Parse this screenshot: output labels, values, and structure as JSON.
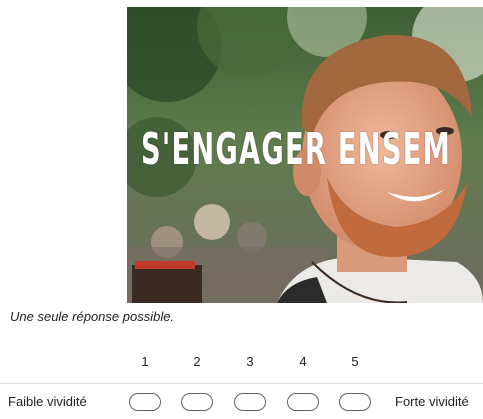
{
  "banner": {
    "overlay_text": "S'ENGAGER ENSEM"
  },
  "question": {
    "hint": "Une seule réponse possible.",
    "scale": [
      "1",
      "2",
      "3",
      "4",
      "5"
    ],
    "low_label": "Faible vividité",
    "high_label": "Forte vividité",
    "selected": null
  }
}
